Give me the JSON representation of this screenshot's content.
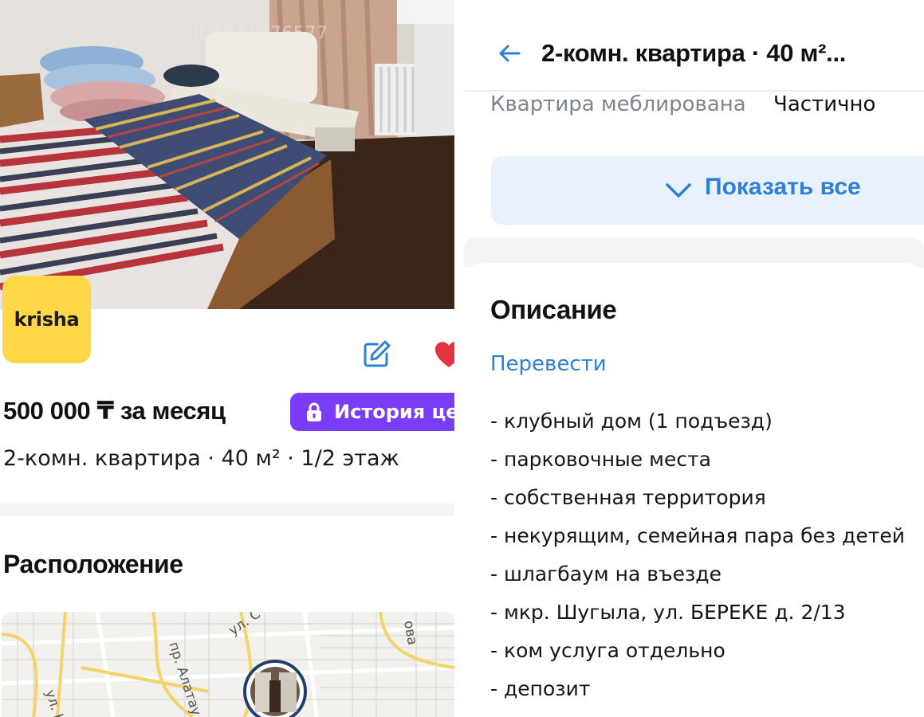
{
  "photo": {
    "watermark": "ID1011076577"
  },
  "brand": {
    "logo_text": "krisha",
    "logo_color": "#ffd747"
  },
  "listing": {
    "price": "500 000 ₸ за месяц",
    "history_button": "История цен",
    "subtitle": "2-комн. квартира · 40 м² · 1/2 этаж",
    "accent_purple": "#7a3cf6"
  },
  "location": {
    "title": "Расположение",
    "map_labels": [
      "пр. Алатау",
      "ул. С",
      "ул. Н",
      "ова"
    ]
  },
  "header": {
    "title": "2-комн. квартира · 40 м²..."
  },
  "params": {
    "furnished_label": "Квартира меблирована",
    "furnished_value": "Частично"
  },
  "show_all": {
    "label": "Показать все",
    "link_color": "#2d7fd7"
  },
  "description": {
    "title": "Описание",
    "translate": "Перевести",
    "items": [
      "- клубный дом (1 подъезд)",
      "- парковочные места",
      "- собственная территория",
      "- некурящим, семейная пара без детей",
      "- шлагбаум на въезде",
      "- мкр. Шугыла, ул. БЕРЕКЕ д. 2/13",
      "- ком услуга отдельно",
      "- депозит"
    ]
  },
  "icons": [
    "edit-icon",
    "heart-icon",
    "lock-icon",
    "back-arrow-icon",
    "chevron-down-icon",
    "map-pin-icon"
  ]
}
